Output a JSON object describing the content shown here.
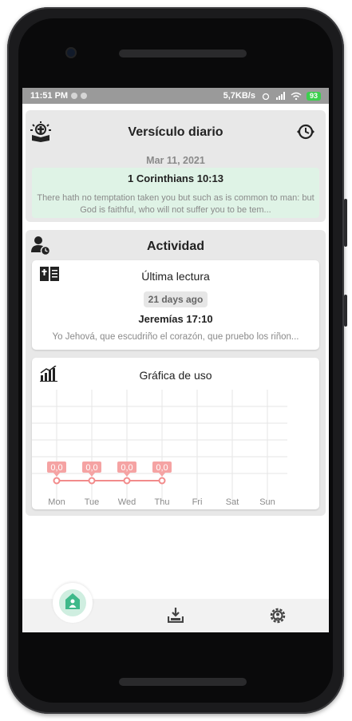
{
  "status": {
    "time": "11:51 PM",
    "network": "5,7KB/s",
    "battery": "93"
  },
  "verse_card": {
    "title": "Versículo diario",
    "date": "Mar 11, 2021",
    "reference": "1 Corinthians 10:13",
    "text": "There hath no temptation taken you but such as is common to man: but God is faithful, who will not suffer you to be tem..."
  },
  "activity": {
    "title": "Actividad",
    "last_reading": {
      "title": "Última lectura",
      "ago": "21 days ago",
      "reference": "Jeremías 17:10",
      "text": "Yo Jehová, que escudriño el corazón, que pruebo los riñon..."
    },
    "usage": {
      "title": "Gráfica de uso"
    }
  },
  "chart_data": {
    "type": "line",
    "categories": [
      "Mon",
      "Tue",
      "Wed",
      "Thu",
      "Fri",
      "Sat",
      "Sun"
    ],
    "series": [
      {
        "values": [
          0.0,
          0.0,
          0.0,
          0.0
        ]
      }
    ],
    "data_labels": [
      "0,0",
      "0,0",
      "0,0",
      "0,0"
    ],
    "line_color": "#f28b8b",
    "label_bg": "#f5a3a3"
  },
  "icons": {
    "verse": "bible-sunrise-icon",
    "history": "clock-history-icon",
    "activity": "user-clock-icon",
    "book": "open-book-icon",
    "chart": "bar-chart-icon",
    "home": "home-icon",
    "download": "download-icon",
    "settings": "settings-icon"
  }
}
